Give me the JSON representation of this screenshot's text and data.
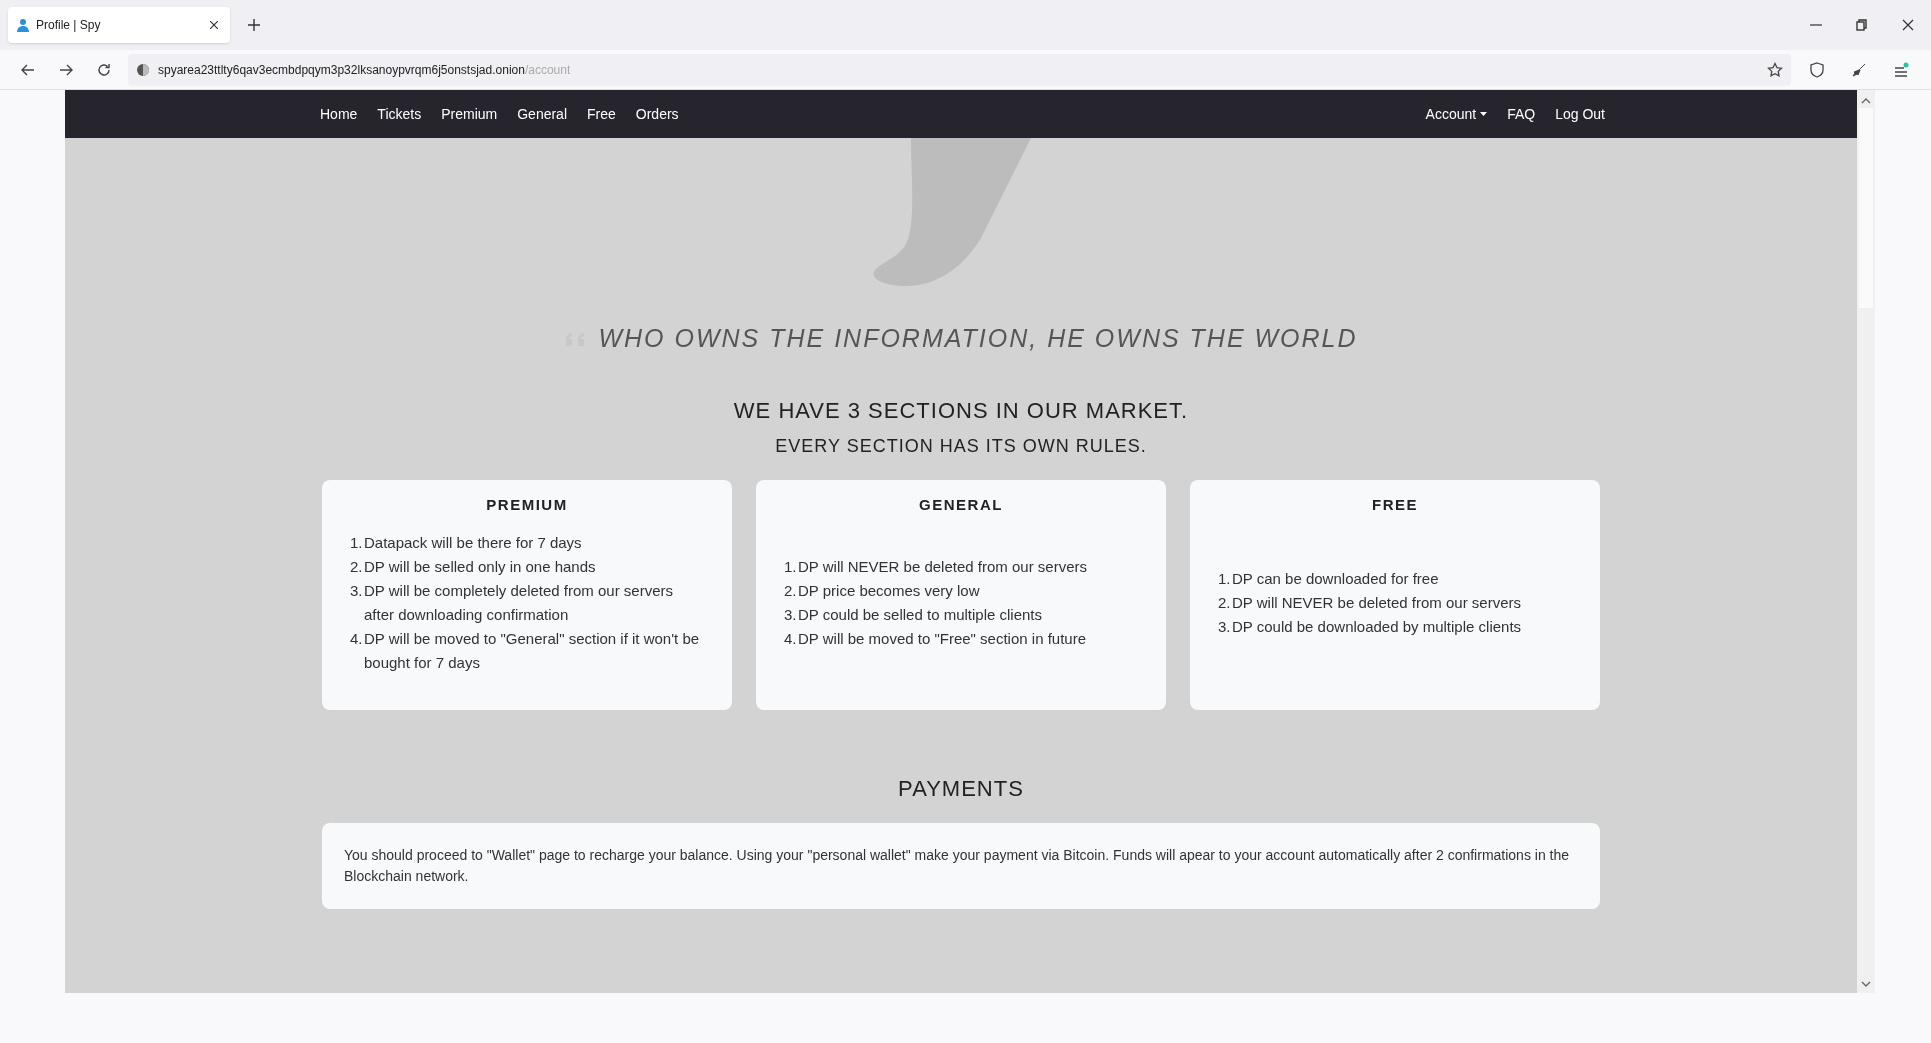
{
  "browser": {
    "tabs": [
      {
        "title": "Profile | Spy",
        "selected": true
      }
    ],
    "url": {
      "host": "spyarea23ttlty6qav3ecmbdpqym3p32lksanoypvrqm6j5onstsjad.onion",
      "path": "/account"
    }
  },
  "nav": {
    "left": [
      {
        "label": "Home",
        "kind": "link"
      },
      {
        "label": "Tickets",
        "kind": "link"
      },
      {
        "label": "Premium",
        "kind": "link"
      },
      {
        "label": "General",
        "kind": "link"
      },
      {
        "label": "Free",
        "kind": "link"
      },
      {
        "label": "Orders",
        "kind": "link"
      }
    ],
    "right": [
      {
        "label": "Account",
        "kind": "dropdown"
      },
      {
        "label": "FAQ",
        "kind": "link"
      },
      {
        "label": "Log Out",
        "kind": "link"
      }
    ]
  },
  "quote": "WHO OWNS THE INFORMATION, HE OWNS THE WORLD",
  "headline": "WE HAVE 3 SECTIONS IN OUR MARKET.",
  "subheadline": "EVERY SECTION HAS ITS OWN RULES.",
  "sections": [
    {
      "title": "PREMIUM",
      "rules": [
        {
          "number": "1.",
          "text": "Datapack will be there for 7 days"
        },
        {
          "number": "2.",
          "text": "DP will be selled only in one hands"
        },
        {
          "number": "3.",
          "text": "DP will be completely deleted from our servers after downloading confirmation"
        },
        {
          "number": "4.",
          "text": "DP will be moved to \"General\" section if it won't be bought for 7 days"
        }
      ]
    },
    {
      "title": "GENERAL",
      "rules": [
        {
          "number": "1.",
          "text": "DP will NEVER be deleted from our servers"
        },
        {
          "number": "2.",
          "text": "DP price becomes very low"
        },
        {
          "number": "3.",
          "text": "DP could be selled to multiple clients"
        },
        {
          "number": "4.",
          "text": "DP will be moved to \"Free\" section in future"
        }
      ]
    },
    {
      "title": "FREE",
      "rules": [
        {
          "number": "1.",
          "text": "DP can be downloaded for free"
        },
        {
          "number": "2.",
          "text": "DP will NEVER be deleted from our servers"
        },
        {
          "number": "3.",
          "text": "DP could be downloaded by multiple clients"
        }
      ]
    }
  ],
  "payments": {
    "title": "PAYMENTS",
    "text": "You should proceed to \"Wallet\" page to recharge your balance. Using your \"personal wallet\" make your payment via Bitcoin. Funds will apear to your account automatically after 2 confirmations in the Blockchain network."
  }
}
